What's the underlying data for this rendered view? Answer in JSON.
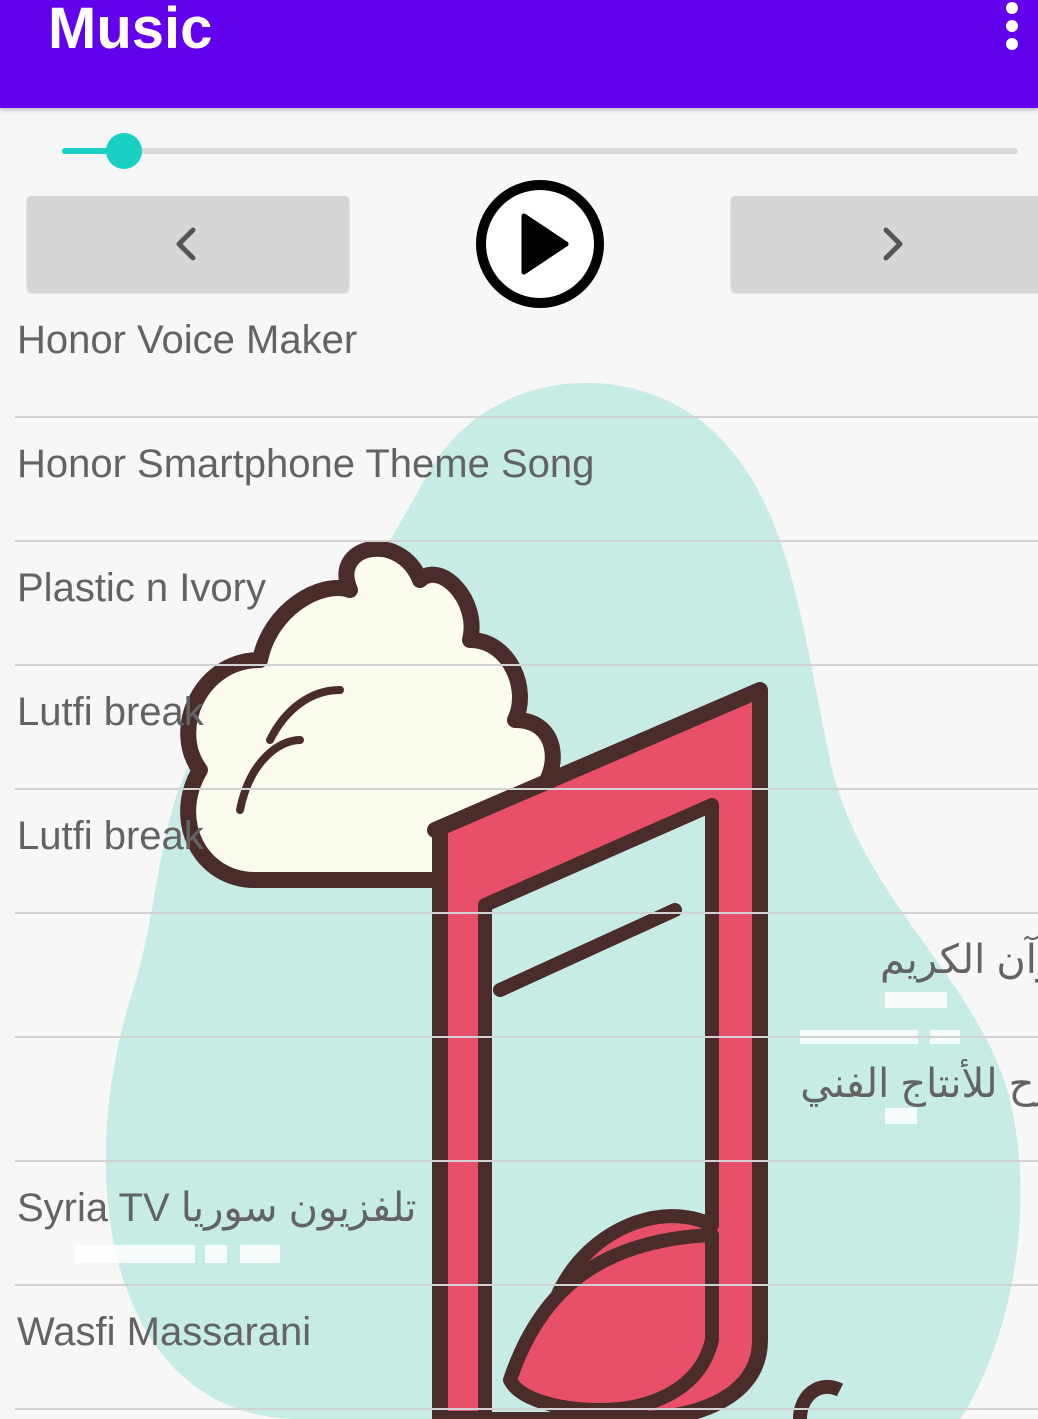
{
  "app_bar": {
    "title": "Music",
    "menu_icon": "more-vert-icon"
  },
  "player": {
    "progress": 0.065,
    "prev_icon": "chevron-left-icon",
    "play_icon": "play-circle-icon",
    "next_icon": "chevron-right-icon"
  },
  "songs": [
    {
      "title": "Honor Voice Maker"
    },
    {
      "title": "Honor Smartphone Theme Song"
    },
    {
      "title": "Plastic n Ivory"
    },
    {
      "title": "Lutfi break"
    },
    {
      "title": "Lutfi break"
    },
    {
      "title": "قرآن الكريم"
    },
    {
      "title": "مرح للأنتاج الفني"
    },
    {
      "title": "Syria TV تلفزيون سوريا"
    },
    {
      "title": "Wasfi Massarani"
    }
  ],
  "colors": {
    "app_bar": "#6200ee",
    "accent": "#1ad0c4",
    "note": "#e8506a",
    "blob": "#c7ebe5"
  }
}
